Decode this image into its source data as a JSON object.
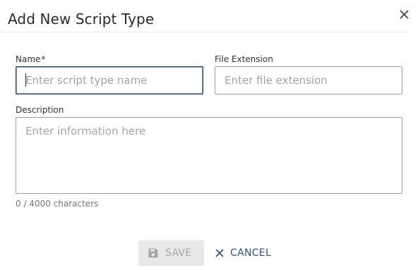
{
  "dialog": {
    "title": "Add New Script Type"
  },
  "form": {
    "name": {
      "label": "Name",
      "required_mark": "*",
      "value": "",
      "placeholder": "Enter script type name"
    },
    "file_extension": {
      "label": "File Extension",
      "value": "",
      "placeholder": "Enter file extension"
    },
    "description": {
      "label": "Description",
      "value": "",
      "placeholder": "Enter information here",
      "char_count": "0 / 4000 characters"
    }
  },
  "actions": {
    "save_label": "SAVE",
    "save_icon": "save-icon",
    "save_disabled": true,
    "cancel_label": "CANCEL",
    "cancel_icon": "close-icon"
  },
  "colors": {
    "primary": "#2f4f8f",
    "focus_border": "#1f3f66",
    "disabled_bg": "#e8e8e8",
    "disabled_text": "#a6a6a6"
  }
}
